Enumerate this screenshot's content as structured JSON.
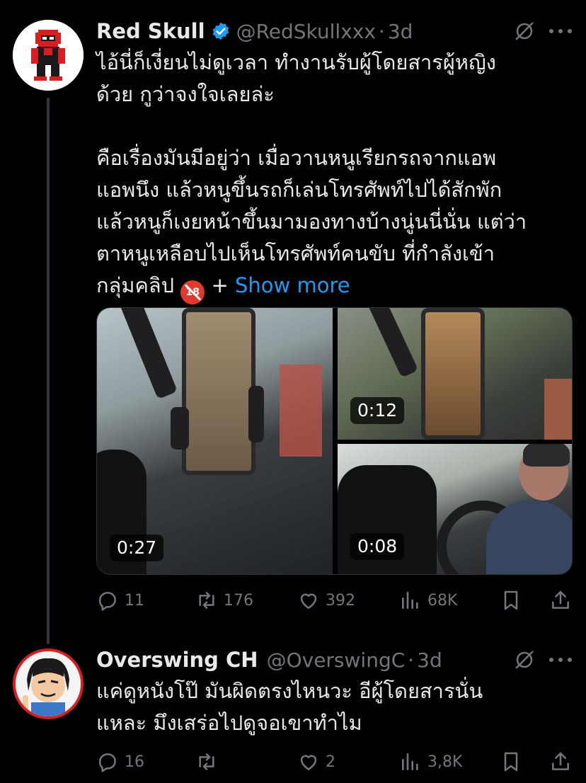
{
  "tweet1": {
    "name": "Red Skull",
    "handle": "@RedSkullxxx",
    "separator": "·",
    "time": "3d",
    "text_lines": [
      "ไอ้นี่ก็เงี่ยนไม่ดูเวลา ทำงานรับผู้โดยสารผู้หญิง",
      "ด้วย กูว่าจงใจเลยล่ะ",
      "",
      "คือเรื่องมันมีอยู่ว่า เมื่อวานหนูเรียกรถจากแอพ",
      "แอพนึง แล้วหนูขึ้นรถก็เล่นโทรศัพท์ไปได้สักพัก",
      "แล้วหนูก็เงยหน้าขึ้นมามองทางบ้างนู่นนี่นั่น แต่ว่า",
      "ตาหนูเหลือบไปเห็นโทรศัพท์คนขับ ที่กำลังเข้า"
    ],
    "last_line_prefix": "กลุ่มคลิป",
    "badge": "18",
    "last_line_plus": " +",
    "show_more": "Show more",
    "media": [
      {
        "duration": "0:27"
      },
      {
        "duration": "0:12"
      },
      {
        "duration": "0:08"
      }
    ],
    "actions": {
      "replies": "11",
      "retweets": "176",
      "likes": "392",
      "views": "68K"
    }
  },
  "tweet2": {
    "name": "Overswing CH",
    "handle": "@OverswingC",
    "separator": "·",
    "time": "3d",
    "text_lines": [
      "แค่ดูหนังโป๊ มันผิดตรงไหนวะ อีผู้โดยสารนั่น",
      "แหละ มึงเสร่อไปดูจอเขาทำไม"
    ],
    "actions": {
      "replies": "16",
      "retweets": "",
      "likes": "2",
      "views": "3,8K"
    }
  },
  "colors": {
    "background": "#000000",
    "text": "#e7e9ea",
    "secondary": "#71767b",
    "link": "#1d9bf0",
    "verified": "#1d9bf0"
  }
}
